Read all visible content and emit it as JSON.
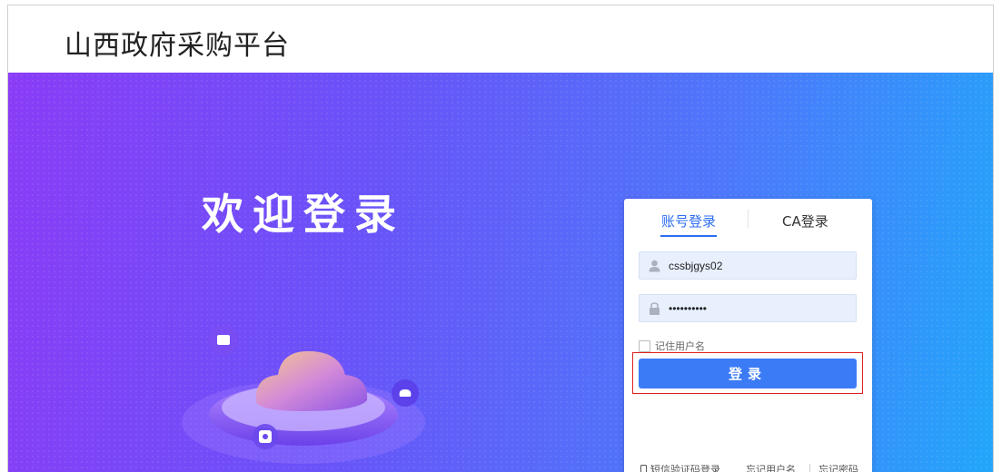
{
  "header": {
    "title": "山西政府采购平台"
  },
  "banner": {
    "welcome": "欢迎登录"
  },
  "login": {
    "tabs": [
      {
        "label": "账号登录",
        "active": true
      },
      {
        "label": "CA登录",
        "active": false
      }
    ],
    "username": {
      "value": "cssbjgys02",
      "icon": "user-icon"
    },
    "password": {
      "value": "••••••••••",
      "icon": "lock-icon"
    },
    "remember_label": "记住用户名",
    "remember_checked": false,
    "submit_label": "登录",
    "footer": {
      "sms_login": "短信验证码登录",
      "forgot_username": "忘记用户名",
      "forgot_password": "忘记密码"
    }
  },
  "colors": {
    "accent": "#2c6df2",
    "button": "#3c7bf6",
    "highlight": "#e02020"
  }
}
